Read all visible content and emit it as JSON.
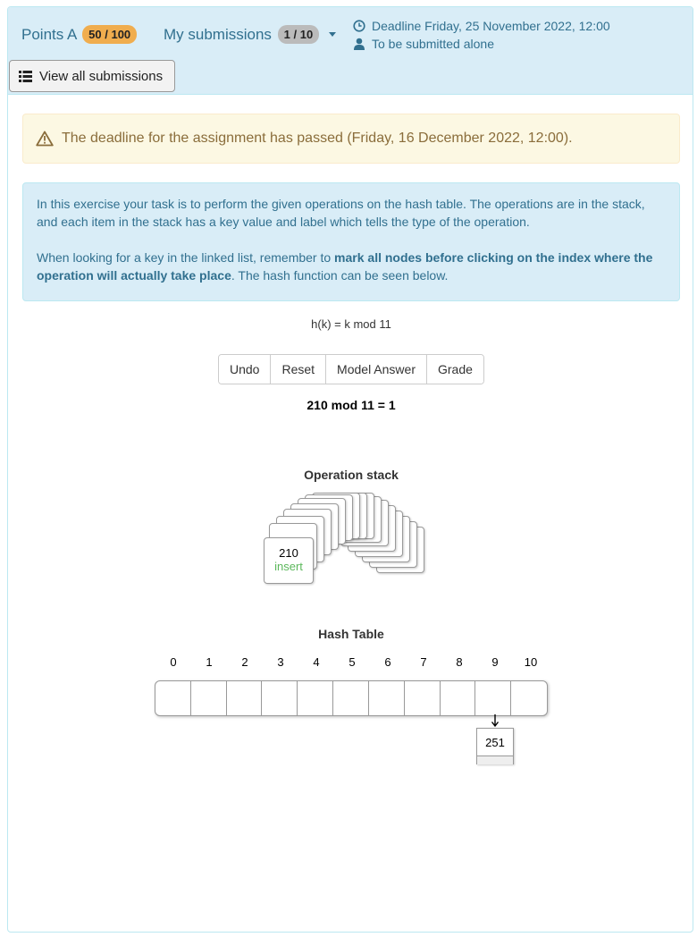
{
  "header": {
    "points_label": "Points A",
    "points_value": "50 / 100",
    "submissions_label": "My submissions",
    "submissions_value": "1 / 10",
    "deadline": "Deadline Friday, 25 November 2022, 12:00",
    "submit_mode": "To be submitted alone",
    "view_all_label": "View all submissions"
  },
  "warning": {
    "text": "The deadline for the assignment has passed (Friday, 16 December 2022, 12:00)."
  },
  "instructions": {
    "p1": "In this exercise your task is to perform the given operations on the hash table. The operations are in the stack, and each item in the stack has a key value and label which tells the type of the operation.",
    "p2_pre": "When looking for a key in the linked list, remember to ",
    "p2_bold": "mark all nodes before clicking on the index where the operation will actually take place",
    "p2_post": ". The hash function can be seen below."
  },
  "hash_function": "h(k) = k mod 11",
  "buttons": {
    "undo": "Undo",
    "reset": "Reset",
    "model_answer": "Model Answer",
    "grade": "Grade"
  },
  "calculation": "210 mod 11 = 1",
  "operation_stack": {
    "title": "Operation stack",
    "top_key": "210",
    "top_label": "insert"
  },
  "hash_table": {
    "title": "Hash Table",
    "indices": [
      "0",
      "1",
      "2",
      "3",
      "4",
      "5",
      "6",
      "7",
      "8",
      "9",
      "10"
    ],
    "chain_node_value": "251"
  },
  "colors": {
    "info_bg": "#d9edf7",
    "info_text": "#31708f",
    "warning_bg": "#fcf8e3",
    "warning_text": "#8a6d3b",
    "points_badge": "#f0ad4e",
    "insert_label": "#5cb85c"
  }
}
